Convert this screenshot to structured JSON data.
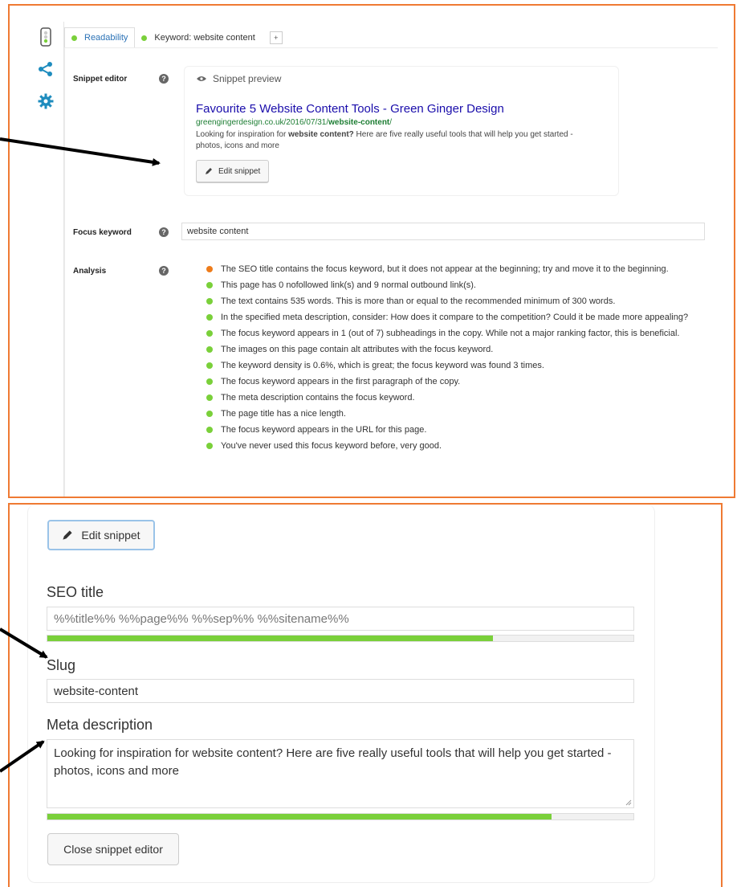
{
  "tabs": [
    {
      "label": "Readability",
      "dot_color": "#7ad03a"
    },
    {
      "label": "Keyword: website content",
      "dot_color": "#7ad03a"
    }
  ],
  "tab_add": "+",
  "sidebar_icons": [
    "traffic-light-icon",
    "share-icon",
    "gear-icon"
  ],
  "snippet_editor": {
    "label": "Snippet editor",
    "preview_heading": "Snippet preview",
    "title": "Favourite 5 Website Content Tools - Green Ginger Design",
    "url_prefix": "greengingerdesign.co.uk/2016/07/31/",
    "url_keyword": "website-content",
    "url_suffix": "/",
    "desc_before": "Looking for inspiration for ",
    "desc_keyword": "website content?",
    "desc_after": " Here are five really useful tools that will help you get started - photos, icons and more",
    "edit_button": "Edit snippet"
  },
  "focus_keyword": {
    "label": "Focus keyword",
    "value": "website content"
  },
  "analysis": {
    "label": "Analysis",
    "items": [
      {
        "text": "The SEO title contains the focus keyword, but it does not appear at the beginning; try and move it to the beginning.",
        "color": "#ee7c1b"
      },
      {
        "text": "This page has 0 nofollowed link(s) and 9 normal outbound link(s).",
        "color": "#7ad03a"
      },
      {
        "text": "The text contains 535 words. This is more than or equal to the recommended minimum of 300 words.",
        "color": "#7ad03a"
      },
      {
        "text": "In the specified meta description, consider: How does it compare to the competition? Could it be made more appealing?",
        "color": "#7ad03a"
      },
      {
        "text": "The focus keyword appears in 1 (out of 7) subheadings in the copy. While not a major ranking factor, this is beneficial.",
        "color": "#7ad03a"
      },
      {
        "text": "The images on this page contain alt attributes with the focus keyword.",
        "color": "#7ad03a"
      },
      {
        "text": "The keyword density is 0.6%, which is great; the focus keyword was found 3 times.",
        "color": "#7ad03a"
      },
      {
        "text": "The focus keyword appears in the first paragraph of the copy.",
        "color": "#7ad03a"
      },
      {
        "text": "The meta description contains the focus keyword.",
        "color": "#7ad03a"
      },
      {
        "text": "The page title has a nice length.",
        "color": "#7ad03a"
      },
      {
        "text": "The focus keyword appears in the URL for this page.",
        "color": "#7ad03a"
      },
      {
        "text": "You've never used this focus keyword before, very good.",
        "color": "#7ad03a"
      }
    ]
  },
  "editor": {
    "edit_button": "Edit snippet",
    "seo_title_label": "SEO title",
    "seo_title_value": "%%title%% %%page%% %%sep%% %%sitename%%",
    "seo_title_progress": 0.76,
    "slug_label": "Slug",
    "slug_value": "website-content",
    "meta_label": "Meta description",
    "meta_value": "Looking for inspiration for website content? Here are five really useful tools that will help you get started - photos, icons and more",
    "meta_progress": 0.86,
    "close_button": "Close snippet editor"
  },
  "colors": {
    "accent_border": "#ef7a33",
    "good": "#7ad03a",
    "warning": "#ee7c1b",
    "link": "#1a0dab",
    "url": "#1e7e34"
  }
}
